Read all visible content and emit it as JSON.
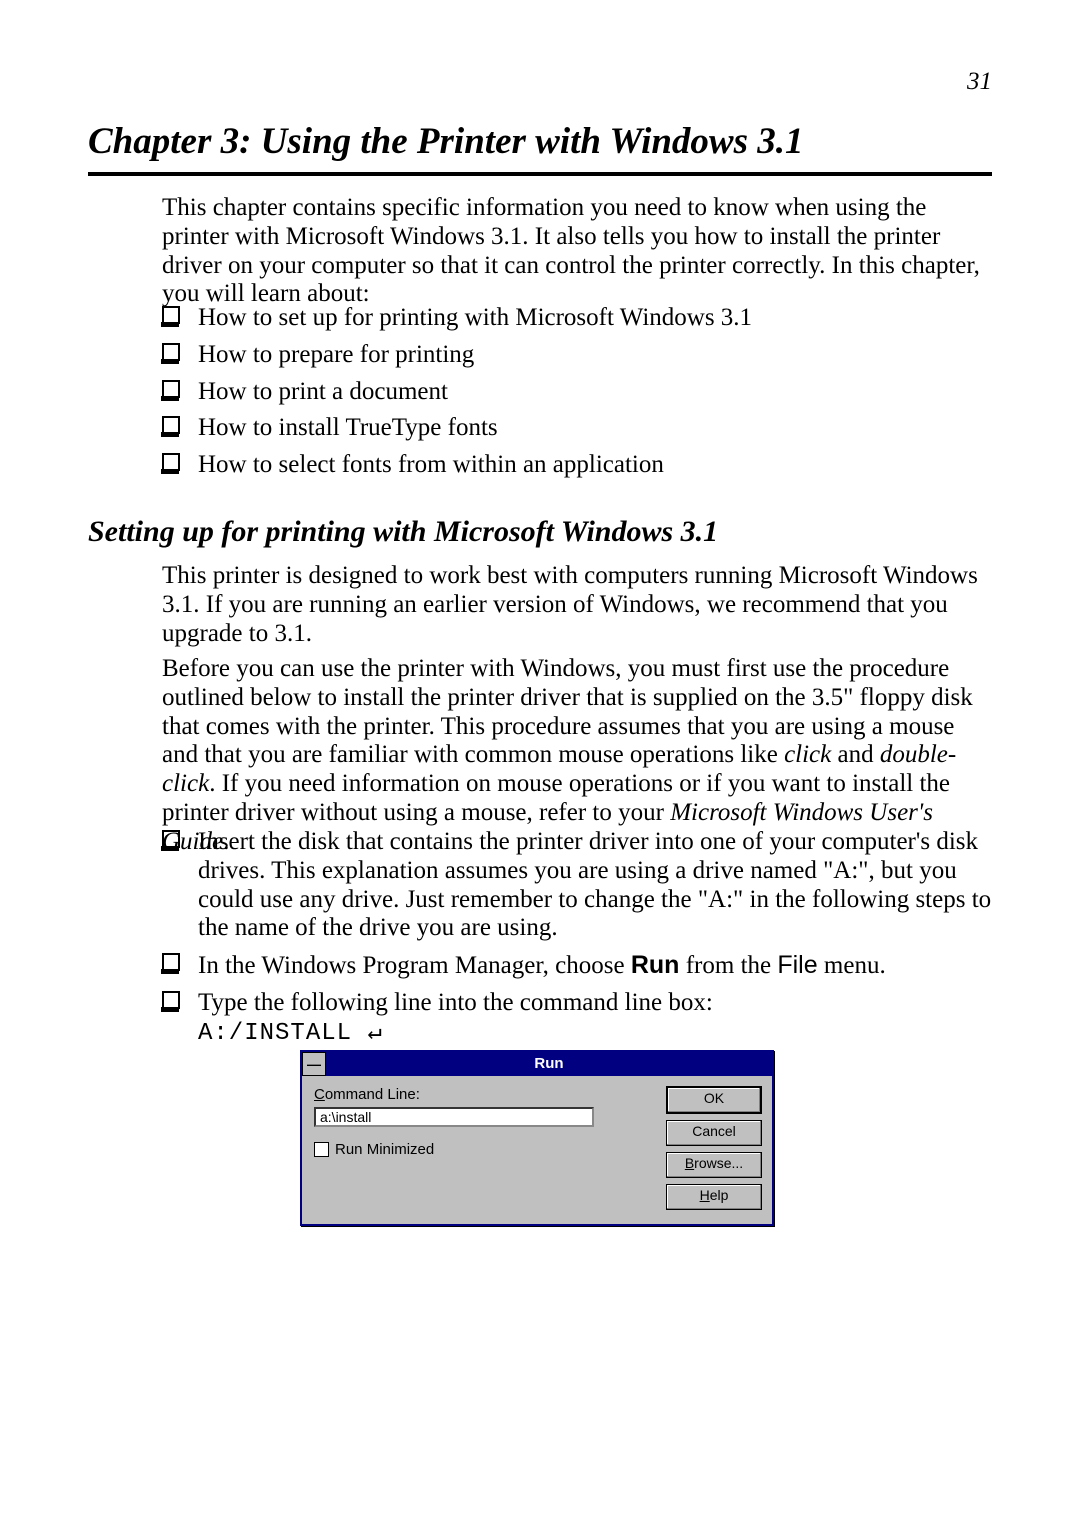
{
  "page_number": "31",
  "chapter_title": "Chapter 3:  Using the Printer with Windows 3.1",
  "intro": "This chapter contains specific information you need to know when using the printer with Microsoft Windows 3.1. It also tells you how to install the printer driver on your computer so that it can control the printer correctly. In this chapter, you will learn about:",
  "topics": [
    "How to set up for printing with Microsoft Windows 3.1",
    "How to prepare for printing",
    "How to print a document",
    "How to install TrueType fonts",
    "How to select fonts from within an application"
  ],
  "section_title": "Setting up for printing with Microsoft Windows 3.1",
  "sec_p1": "This printer is designed to work best with computers running Microsoft Windows 3.1. If you are running an earlier version of Windows, we recommend that you upgrade to 3.1.",
  "sec_p2": {
    "a": "Before you can use the printer with Windows, you must first use the procedure outlined below to install the printer driver that is supplied on the 3.5\" floppy disk that comes with the printer. This procedure assumes that you are using a mouse and that you are familiar with common mouse operations like ",
    "b": "click",
    "c": " and ",
    "d": "double-click",
    "e": ". If you need information on mouse operations or if you want to install the printer driver without using a mouse, refer to your ",
    "f": "Microsoft Windows User's Guide",
    "g": "."
  },
  "steps": {
    "s1": "Insert the disk that contains the printer driver into one of your computer's disk drives. This explanation assumes you are using a drive named \"A:\", but you could use any drive. Just remember to change the \"A:\" in the following steps to the name of the drive you are using.",
    "s2a": "In the Windows Program Manager, choose ",
    "s2b": "Run",
    "s2c": " from the ",
    "s2d": "File",
    "s2e": " menu.",
    "s3": "Type the following line into the command line box:",
    "cmd": "A:/INSTALL ↵"
  },
  "dialog": {
    "title": "Run",
    "sysmenu_glyph": "—",
    "cmd_label_ul": "C",
    "cmd_label_rest": "ommand Line:",
    "cmd_value": "a:\\install",
    "runmin_ul": "M",
    "runmin_before": "Run ",
    "runmin_after": "inimized",
    "ok": "OK",
    "cancel": "Cancel",
    "browse_ul": "B",
    "browse_rest": "rowse...",
    "help_ul": "H",
    "help_rest": "elp"
  }
}
